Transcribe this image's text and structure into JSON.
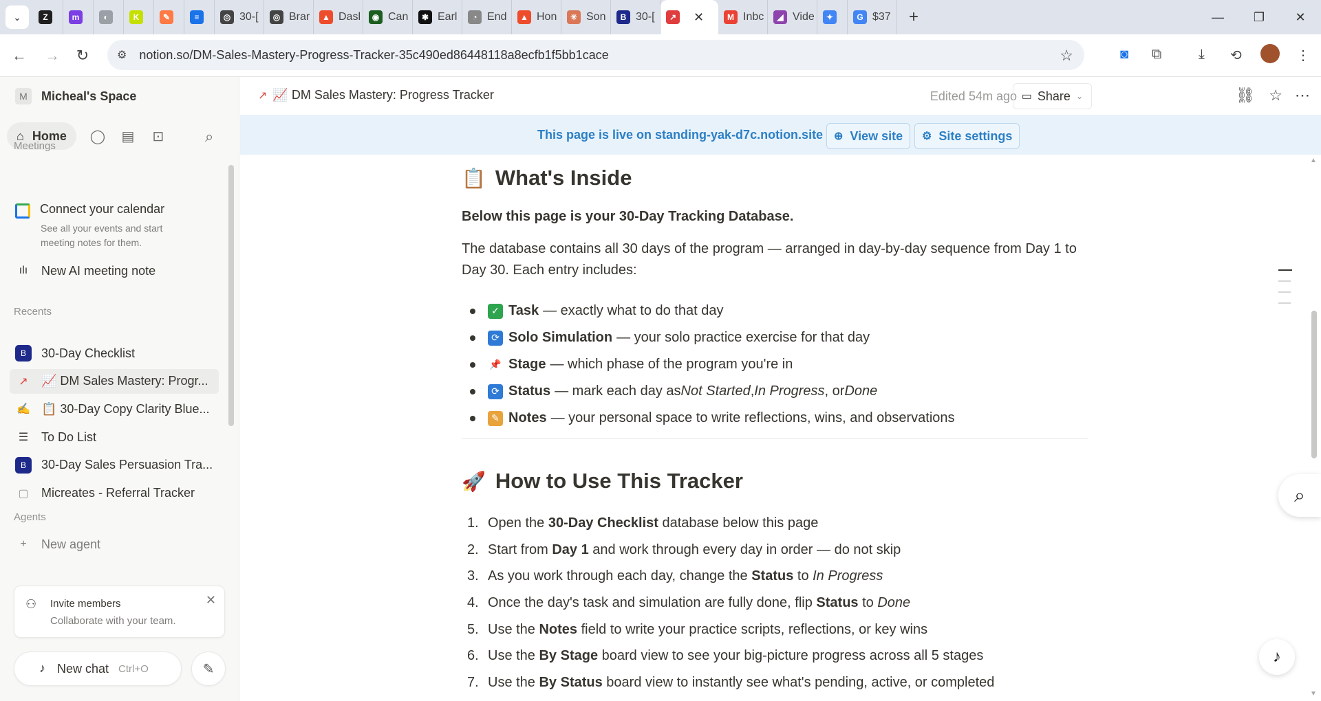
{
  "browser": {
    "tabs": [
      {
        "label": "",
        "fav": "Z",
        "color": "#1f1f1f"
      },
      {
        "label": "",
        "fav": "m",
        "color": "#7b3fe4"
      },
      {
        "label": "",
        "fav": "◐",
        "color": "#9aa0a6"
      },
      {
        "label": "",
        "fav": "K",
        "color": "#c5e000"
      },
      {
        "label": "",
        "fav": "✎",
        "color": "#ff7a45"
      },
      {
        "label": "",
        "fav": "≡",
        "color": "#1a73e8"
      },
      {
        "label": "30-[",
        "fav": "◎",
        "color": "#444444"
      },
      {
        "label": "Brar",
        "fav": "◎",
        "color": "#444444"
      },
      {
        "label": "Dasl",
        "fav": "▲",
        "color": "#ee4d2d"
      },
      {
        "label": "Can",
        "fav": "◉",
        "color": "#1b5e20"
      },
      {
        "label": "Earl",
        "fav": "✱",
        "color": "#111111"
      },
      {
        "label": "End",
        "fav": "◔",
        "color": "#888888"
      },
      {
        "label": "Hon",
        "fav": "▲",
        "color": "#ee4d2d"
      },
      {
        "label": "Son",
        "fav": "✳",
        "color": "#d97757"
      },
      {
        "label": "30-[",
        "fav": "B",
        "color": "#1e2a8a"
      },
      {
        "label": "",
        "fav": "↗",
        "color": "#e03e3e",
        "active": true
      },
      {
        "label": "Inbc",
        "fav": "M",
        "color": "#ea4335"
      },
      {
        "label": "Vide",
        "fav": "◢",
        "color": "#8e44ad"
      },
      {
        "label": "",
        "fav": "✦",
        "color": "#4285f4"
      },
      {
        "label": "$37",
        "fav": "G",
        "color": "#4285f4"
      }
    ],
    "url": "notion.so/DM-Sales-Mastery-Progress-Tracker-35c490ed86448118a8ecfb1f5bb1cace"
  },
  "sidebar": {
    "workspace_initial": "M",
    "workspace_name": "Micheal's Space",
    "home_label": "Home",
    "meetings_label": "Meetings",
    "calendar_title": "Connect your calendar",
    "calendar_sub": "See all your events and start meeting notes for them.",
    "new_ai_note": "New AI meeting note",
    "recents_label": "Recents",
    "recents": [
      {
        "label": "30-Day Checklist",
        "icon": "B",
        "color": "#1e2a8a"
      },
      {
        "label": "📈 DM Sales Mastery: Progr...",
        "icon": "↗",
        "color": "#e03e3e",
        "selected": true
      },
      {
        "label": "📋 30-Day Copy Clarity Blue...",
        "icon": "✍",
        "color": "#e8a33d"
      },
      {
        "label": "To Do List",
        "icon": "☰",
        "color": "#37352f"
      },
      {
        "label": "30-Day Sales Persuasion Tra...",
        "icon": "B",
        "color": "#1e2a8a"
      },
      {
        "label": "Micreates - Referral Tracker",
        "icon": "▢",
        "color": "#9b9a97"
      }
    ],
    "agents_label": "Agents",
    "new_agent": "New agent",
    "invite_title": "Invite members",
    "invite_sub": "Collaborate with your team.",
    "new_chat": "New chat",
    "new_chat_kbd": "Ctrl+O"
  },
  "topbar": {
    "breadcrumb": "📈 DM Sales Mastery: Progress Tracker",
    "edited": "Edited 54m ago",
    "share": "Share"
  },
  "banner": {
    "text": "This page is live on standing-yak-d7c.notion.site",
    "view_site": "View site",
    "site_settings": "Site settings"
  },
  "content": {
    "section1_title": "What's Inside",
    "section1_emoji": "📋",
    "intro_bold": "Below this page is your 30-Day Tracking Database.",
    "intro_text": "The database contains all 30 days of the program — arranged in day-by-day sequence from Day 1 to Day 30. Each entry includes:",
    "bullets": [
      {
        "emoji": "✓",
        "color": "#2ea44f",
        "bold": "Task",
        "rest": "— exactly what to do that day"
      },
      {
        "emoji": "⟳",
        "color": "#2f7ad6",
        "bold": "Solo Simulation",
        "rest": "— your solo practice exercise for that day"
      },
      {
        "emoji": "📌",
        "color": "transparent",
        "bold": "Stage",
        "rest": "— which phase of the program you're in"
      },
      {
        "emoji": "⟳",
        "color": "#2f7ad6",
        "bold": "Status",
        "rest": "— mark each day as",
        "italics": [
          "Not Started",
          "In Progress",
          "Done"
        ]
      },
      {
        "emoji": "✎",
        "color": "#e8a33d",
        "bold": "Notes",
        "rest": "— your personal space to write reflections, wins, and observations"
      }
    ],
    "section2_title": "How to Use This Tracker",
    "section2_emoji": "🚀",
    "steps": [
      {
        "n": "1.",
        "parts": [
          [
            "t",
            "Open the "
          ],
          [
            "b",
            "30-Day Checklist"
          ],
          [
            "t",
            " database below this page"
          ]
        ]
      },
      {
        "n": "2.",
        "parts": [
          [
            "t",
            "Start from "
          ],
          [
            "b",
            "Day 1"
          ],
          [
            "t",
            " and work through every day in order — do not skip"
          ]
        ]
      },
      {
        "n": "3.",
        "parts": [
          [
            "t",
            "As you work through each day, change the "
          ],
          [
            "b",
            "Status"
          ],
          [
            "t",
            " to "
          ],
          [
            "i",
            "In Progress"
          ]
        ]
      },
      {
        "n": "4.",
        "parts": [
          [
            "t",
            "Once the day's task and simulation are fully done, flip "
          ],
          [
            "b",
            "Status"
          ],
          [
            "t",
            " to "
          ],
          [
            "i",
            "Done"
          ]
        ]
      },
      {
        "n": "5.",
        "parts": [
          [
            "t",
            "Use the "
          ],
          [
            "b",
            "Notes"
          ],
          [
            "t",
            " field to write your practice scripts, reflections, or key wins"
          ]
        ]
      },
      {
        "n": "6.",
        "parts": [
          [
            "t",
            "Use the "
          ],
          [
            "b",
            "By Stage"
          ],
          [
            "t",
            " board view to see your big-picture progress across all 5 stages"
          ]
        ]
      },
      {
        "n": "7.",
        "parts": [
          [
            "t",
            "Use the "
          ],
          [
            "b",
            "By Status"
          ],
          [
            "t",
            " board view to instantly see what's pending, active, or completed"
          ]
        ]
      }
    ]
  }
}
